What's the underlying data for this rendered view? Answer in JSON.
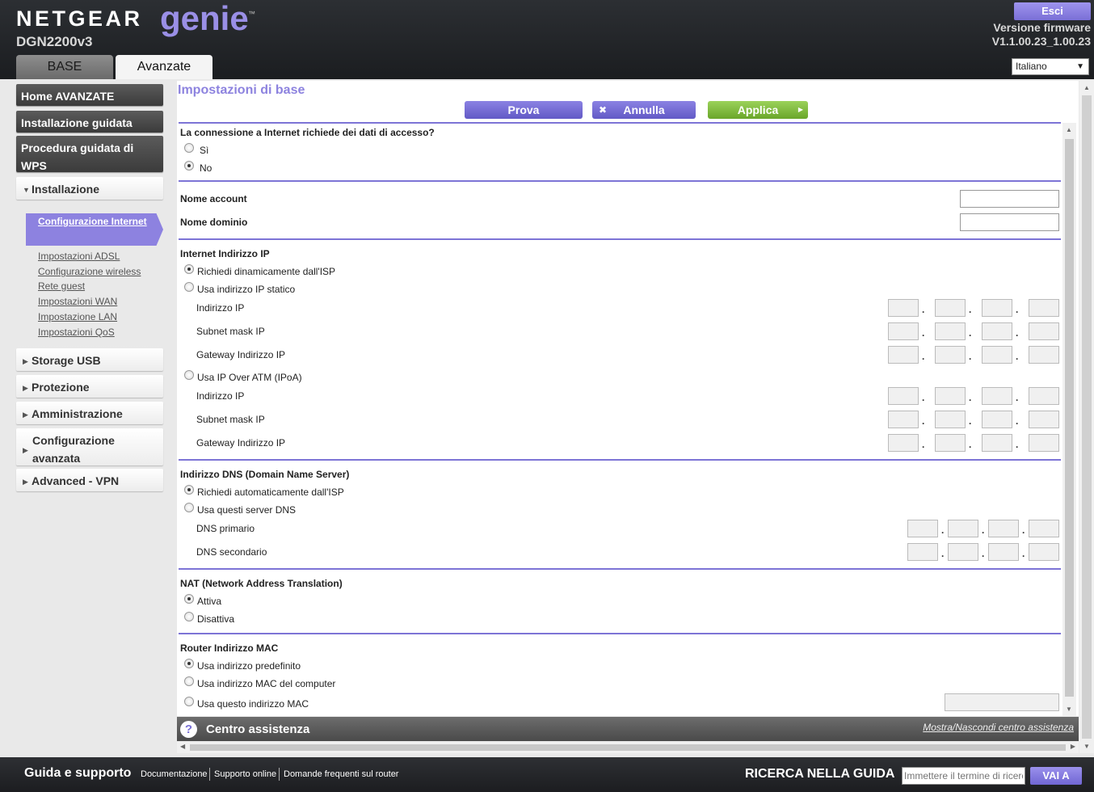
{
  "header": {
    "brand": "NETGEAR",
    "product": "genie",
    "trademark": "™",
    "model": "DGN2200v3",
    "logout_label": "Esci",
    "firmware_label": "Versione firmware",
    "firmware_version": "V1.1.00.23_1.00.23",
    "language": "Italiano",
    "tabs": [
      {
        "label": "BASE",
        "active": false
      },
      {
        "label": "Avanzate",
        "active": true
      }
    ]
  },
  "sidebar": {
    "items": [
      {
        "label": "Home AVANZATE"
      },
      {
        "label": "Installazione guidata"
      },
      {
        "label": "Procedura guidata di WPS"
      },
      {
        "label": "Installazione",
        "expanded": true
      },
      {
        "label": "Storage USB"
      },
      {
        "label": "Protezione"
      },
      {
        "label": "Amministrazione"
      },
      {
        "label": "Configurazione avanzata"
      },
      {
        "label": "Advanced - VPN"
      }
    ],
    "subitems": [
      {
        "label": "Configurazione Internet",
        "active": true
      },
      {
        "label": "Impostazioni ADSL"
      },
      {
        "label": "Configurazione wireless"
      },
      {
        "label": "Rete guest"
      },
      {
        "label": "Impostazioni WAN"
      },
      {
        "label": "Impostazione LAN"
      },
      {
        "label": "Impostazioni QoS"
      }
    ]
  },
  "main": {
    "title": "Impostazioni di base",
    "buttons": {
      "test": "Prova",
      "cancel": "Annulla",
      "apply": "Applica"
    },
    "login_section": {
      "question": "La connessione a Internet richiede dei dati di accesso?",
      "options": [
        {
          "label": "Sì",
          "selected": false
        },
        {
          "label": "No",
          "selected": true
        }
      ]
    },
    "account": {
      "account_name_label": "Nome account",
      "account_name_value": "",
      "domain_name_label": "Nome dominio",
      "domain_name_value": ""
    },
    "internet_ip": {
      "title": "Internet Indirizzo IP",
      "dynamic_label": "Richiedi dinamicamente dall'ISP",
      "dynamic_selected": true,
      "static_label": "Usa indirizzo IP statico",
      "static_fields": [
        "Indirizzo IP",
        "Subnet mask IP",
        "Gateway Indirizzo IP"
      ],
      "ipoa_label": "Usa IP Over ATM (IPoA)",
      "ipoa_fields": [
        "Indirizzo IP",
        "Subnet mask IP",
        "Gateway Indirizzo IP"
      ]
    },
    "dns": {
      "title": "Indirizzo DNS (Domain Name Server)",
      "auto_label": "Richiedi automaticamente dall'ISP",
      "auto_selected": true,
      "manual_label": "Usa questi server DNS",
      "fields": [
        "DNS primario",
        "DNS secondario"
      ]
    },
    "nat": {
      "title": "NAT (Network Address Translation)",
      "options": [
        {
          "label": "Attiva",
          "selected": true
        },
        {
          "label": "Disattiva",
          "selected": false
        }
      ]
    },
    "mac": {
      "title": "Router Indirizzo MAC",
      "options": [
        {
          "label": "Usa indirizzo predefinito",
          "selected": true
        },
        {
          "label": "Usa indirizzo MAC del computer",
          "selected": false
        },
        {
          "label": "Usa questo indirizzo MAC",
          "selected": false
        }
      ]
    },
    "ip_separator": "."
  },
  "help": {
    "title": "Centro assistenza",
    "toggle": "Mostra/Nascondi centro assistenza",
    "icon": "?"
  },
  "footer": {
    "title": "Guida e supporto",
    "links": [
      "Documentazione",
      "Supporto online",
      "Domande frequenti sul router"
    ],
    "search_label": "RICERCA NELLA GUIDA",
    "search_placeholder": "Immettere il termine di ricerca",
    "search_button": "VAI A"
  },
  "colors": {
    "accent": "#8d83df",
    "apply": "#7bb83a",
    "header": "#222427"
  }
}
